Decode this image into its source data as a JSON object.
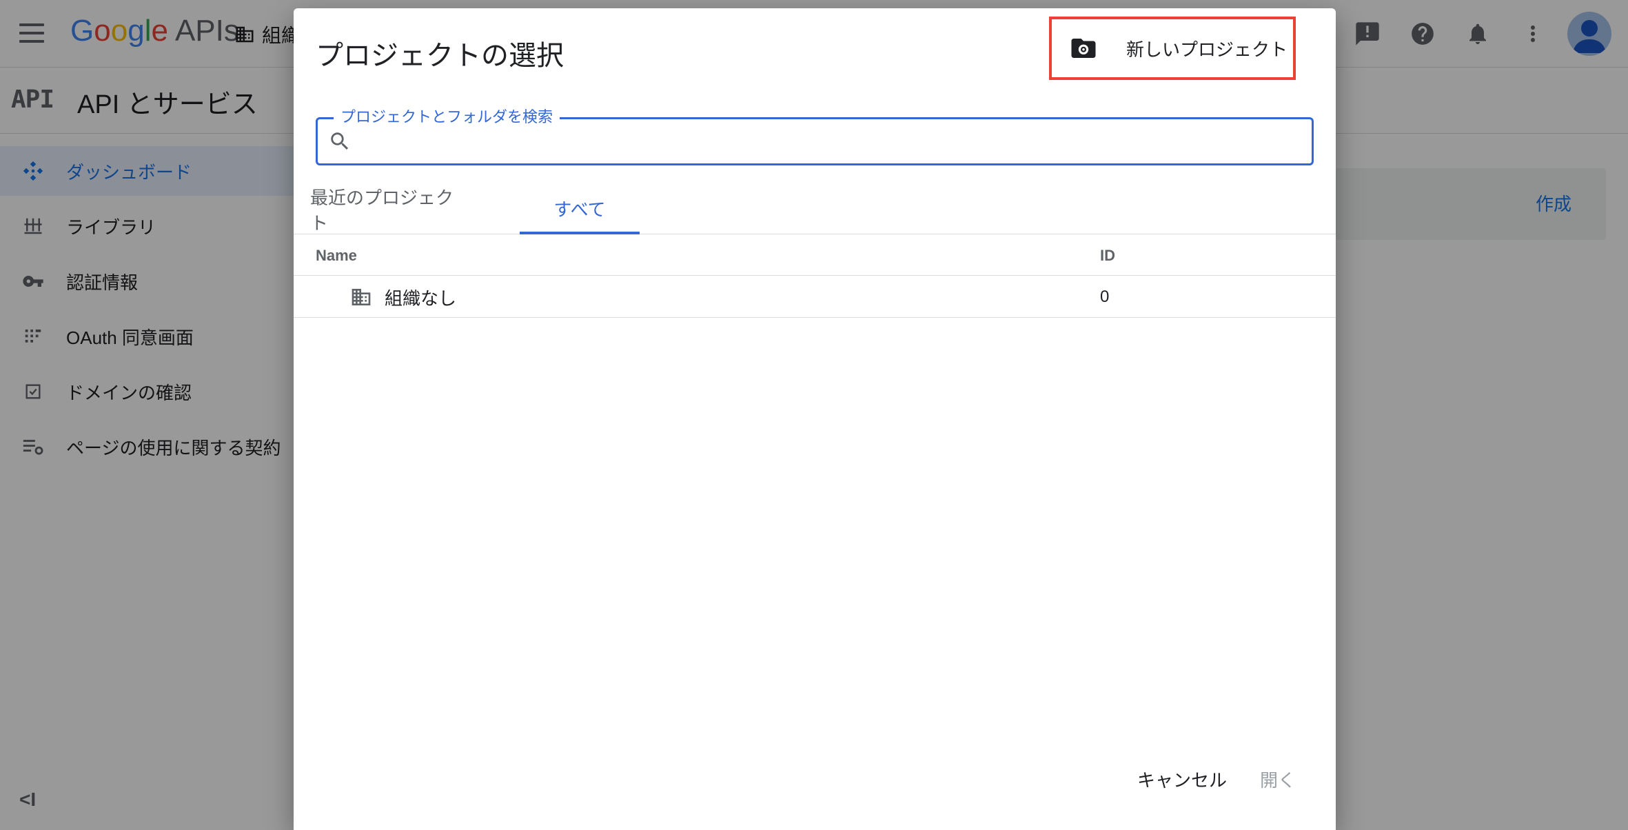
{
  "app": {
    "logo_letters": [
      "G",
      "o",
      "o",
      "g",
      "l",
      "e"
    ],
    "logo_suffix": "APIs",
    "org_picker_label": "組織",
    "colors": {
      "google_blue": "#4285f4",
      "google_red": "#ea4335",
      "google_yellow": "#fbbc05",
      "google_green": "#34a853",
      "accent": "#1a73e8",
      "highlight_box": "#ea4335"
    }
  },
  "topbar": {
    "icons": [
      "alert-icon",
      "help-icon",
      "notifications-icon",
      "more-vert-icon",
      "account-avatar"
    ]
  },
  "page": {
    "api_logo": "API",
    "title": "API とサービス"
  },
  "sidebar": {
    "items": [
      {
        "label": "ダッシュボード",
        "icon": "dashboard-icon",
        "active": true
      },
      {
        "label": "ライブラリ",
        "icon": "library-icon",
        "active": false
      },
      {
        "label": "認証情報",
        "icon": "key-icon",
        "active": false
      },
      {
        "label": "OAuth 同意画面",
        "icon": "oauth-consent-icon",
        "active": false
      },
      {
        "label": "ドメインの確認",
        "icon": "checkbox-icon",
        "active": false
      },
      {
        "label": "ページの使用に関する契約",
        "icon": "page-settings-icon",
        "active": false
      }
    ],
    "collapse_label": "<I"
  },
  "background": {
    "create_label": "作成"
  },
  "dialog": {
    "title": "プロジェクトの選択",
    "new_project_label": "新しいプロジェクト",
    "search": {
      "label": "プロジェクトとフォルダを検索",
      "value": "",
      "placeholder": ""
    },
    "tabs": [
      {
        "label": "最近のプロジェクト",
        "active": false
      },
      {
        "label": "すべて",
        "active": true
      }
    ],
    "table": {
      "columns": [
        "Name",
        "ID"
      ],
      "rows": [
        {
          "name": "組織なし",
          "id": "0",
          "icon": "organization-icon"
        }
      ]
    },
    "buttons": {
      "cancel": "キャンセル",
      "open": "開く"
    }
  }
}
